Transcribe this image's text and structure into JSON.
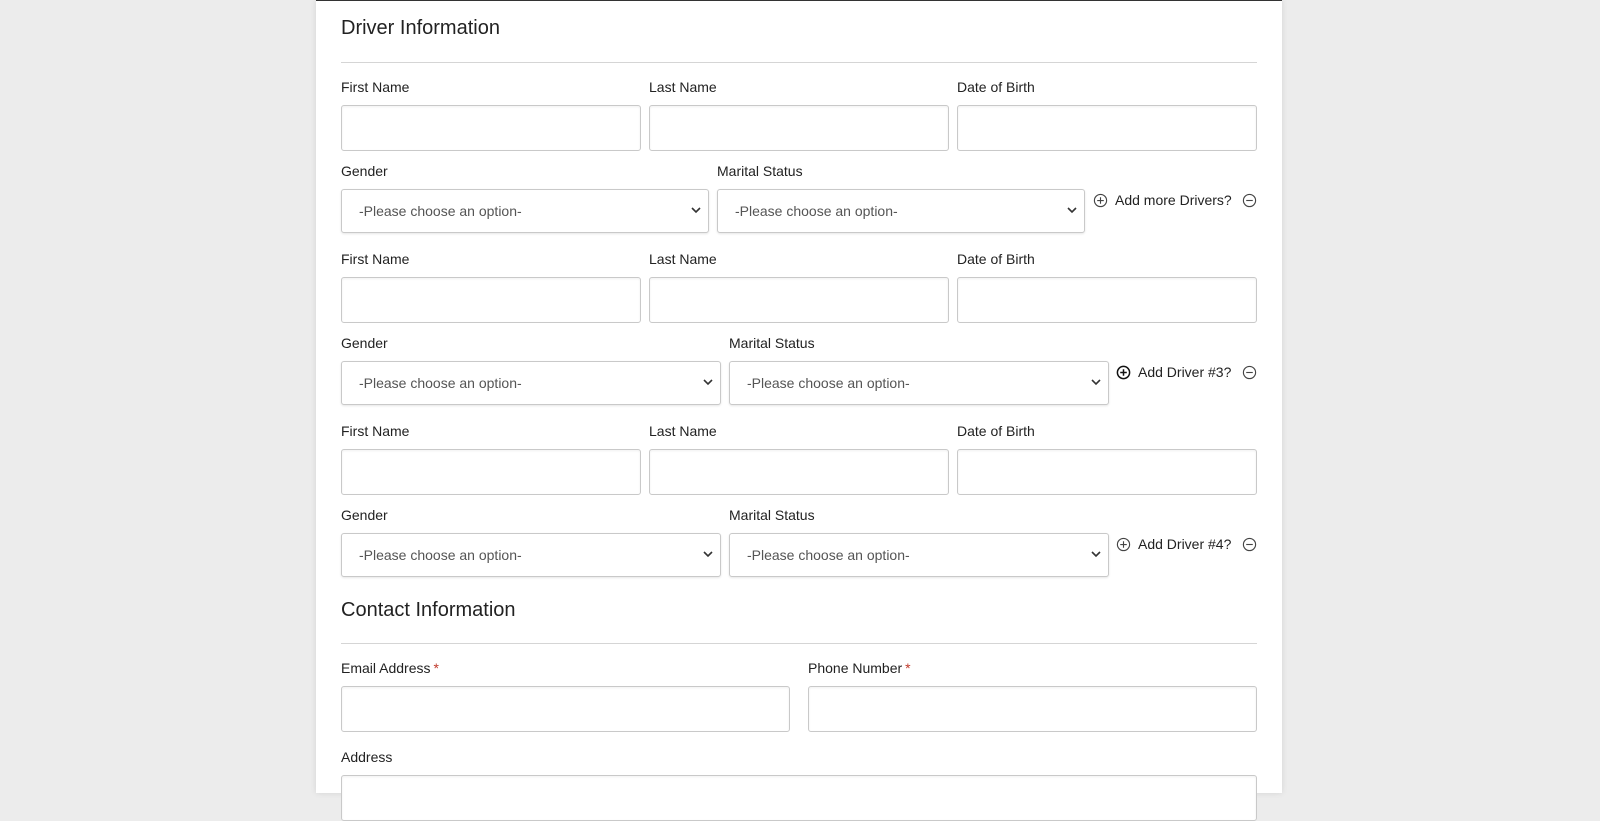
{
  "driver_section": {
    "title": "Driver Information",
    "rows": [
      {
        "first_name_label": "First Name",
        "last_name_label": "Last Name",
        "dob_label": "Date of Birth",
        "gender_label": "Gender",
        "marital_label": "Marital Status",
        "gender_value": "-Please choose an option-",
        "marital_value": "-Please choose an option-",
        "add_label": "Add more Drivers?"
      },
      {
        "first_name_label": "First Name",
        "last_name_label": "Last Name",
        "dob_label": "Date of Birth",
        "gender_label": "Gender",
        "marital_label": "Marital Status",
        "gender_value": "-Please choose an option-",
        "marital_value": "-Please choose an option-",
        "add_label": "Add Driver #3?"
      },
      {
        "first_name_label": "First Name",
        "last_name_label": "Last Name",
        "dob_label": "Date of Birth",
        "gender_label": "Gender",
        "marital_label": "Marital Status",
        "gender_value": "-Please choose an option-",
        "marital_value": "-Please choose an option-",
        "add_label": "Add Driver #4?"
      }
    ]
  },
  "contact_section": {
    "title": "Contact Information",
    "email_label": "Email Address",
    "phone_label": "Phone Number",
    "required_mark": "*",
    "address_label": "Address"
  },
  "colors": {
    "page_bg": "#ececec",
    "card_bg": "#ffffff",
    "required": "#c0392b",
    "border": "#c9c9c9"
  },
  "icons": [
    "plus-circle-icon",
    "minus-circle-icon",
    "chevron-down-icon"
  ]
}
